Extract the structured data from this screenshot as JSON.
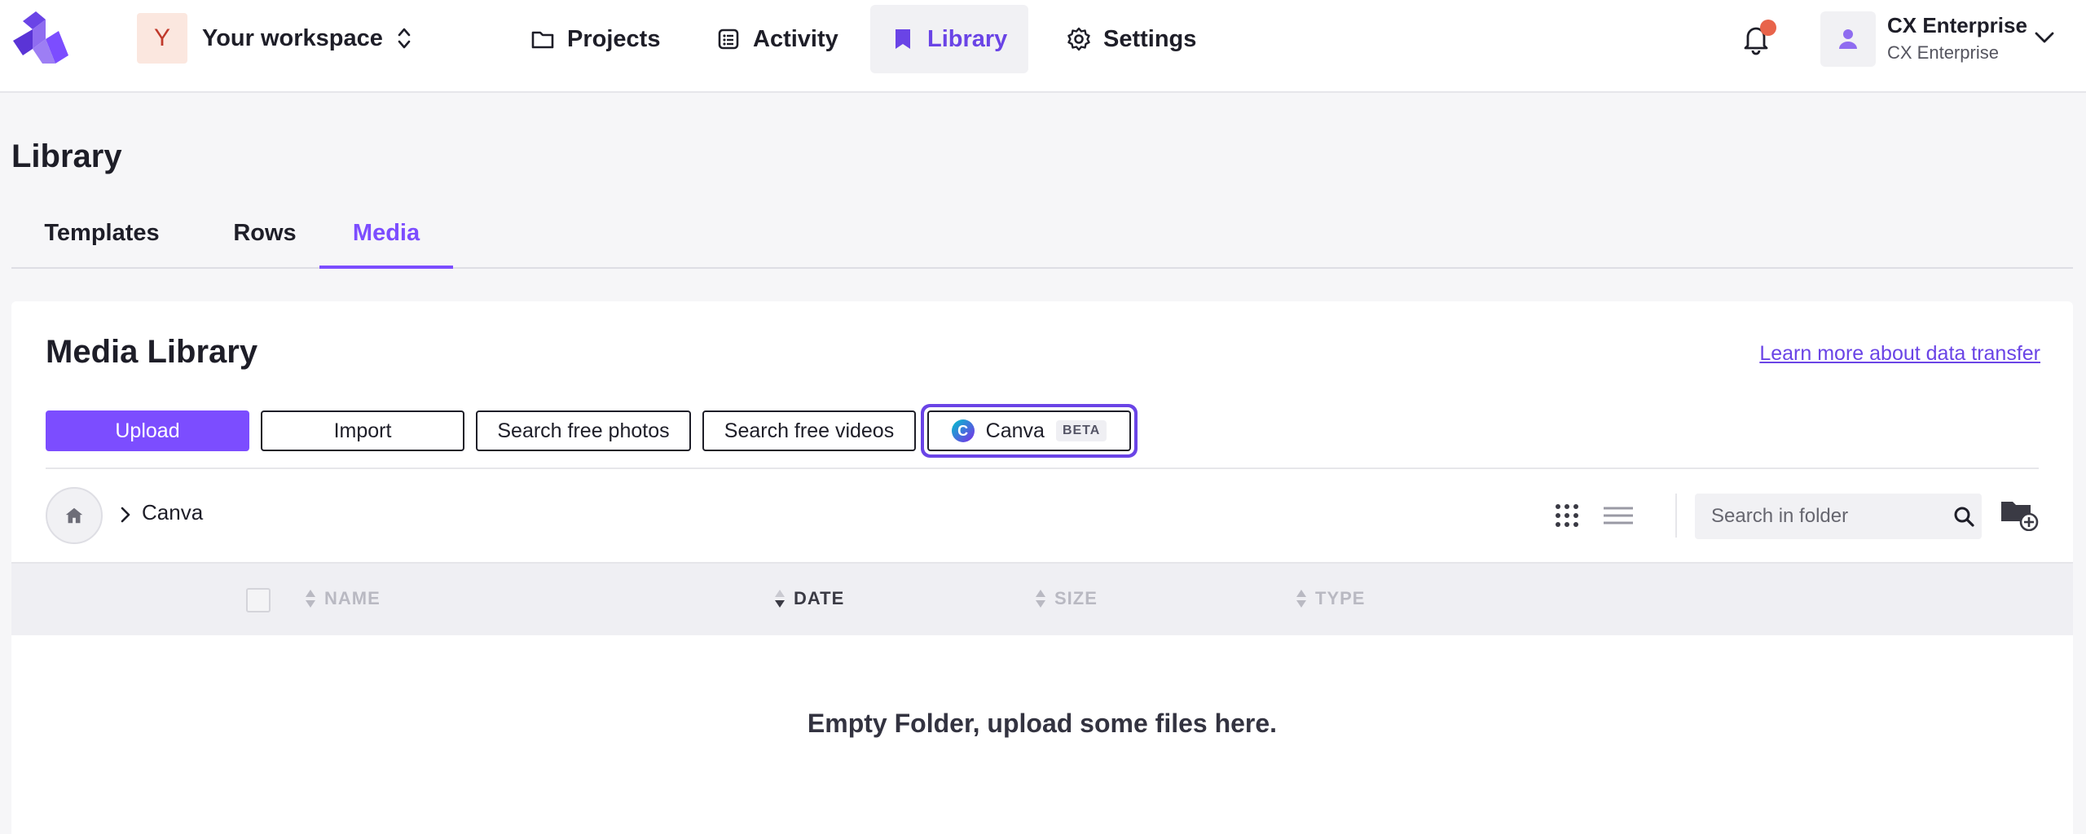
{
  "workspace": {
    "initial": "Y",
    "name": "Your workspace"
  },
  "nav": {
    "projects": "Projects",
    "activity": "Activity",
    "library": "Library",
    "settings": "Settings"
  },
  "user": {
    "name": "CX Enterprise",
    "org": "CX Enterprise"
  },
  "page": {
    "title": "Library"
  },
  "tabs": [
    {
      "label": "Templates"
    },
    {
      "label": "Rows"
    },
    {
      "label": "Media",
      "active": true
    }
  ],
  "media": {
    "title": "Media Library",
    "learn_more": "Learn more about data transfer",
    "buttons": {
      "upload": "Upload",
      "import": "Import",
      "search_photos": "Search free photos",
      "search_videos": "Search free videos",
      "canva": "Canva",
      "canva_badge": "BETA",
      "canva_logo": "C"
    },
    "breadcrumb": {
      "current": "Canva"
    },
    "search": {
      "placeholder": "Search in folder",
      "value": ""
    },
    "columns": [
      "NAME",
      "DATE",
      "SIZE",
      "TYPE"
    ],
    "sorted_column": "DATE",
    "empty_message": "Empty Folder, upload some files here."
  },
  "colors": {
    "accent": "#7c4dff",
    "accent_dark": "#6a44e6",
    "notification": "#e8644b"
  },
  "icons": {
    "logo": "brand-logo-icon",
    "projects": "folder-icon",
    "activity": "list-icon",
    "library": "bookmark-icon",
    "settings": "gear-icon",
    "notifications": "bell-icon",
    "user": "user-icon",
    "home": "home-icon",
    "grid_view": "grid-view-icon",
    "list_view": "list-view-icon",
    "search": "search-icon",
    "new_folder": "new-folder-icon"
  }
}
